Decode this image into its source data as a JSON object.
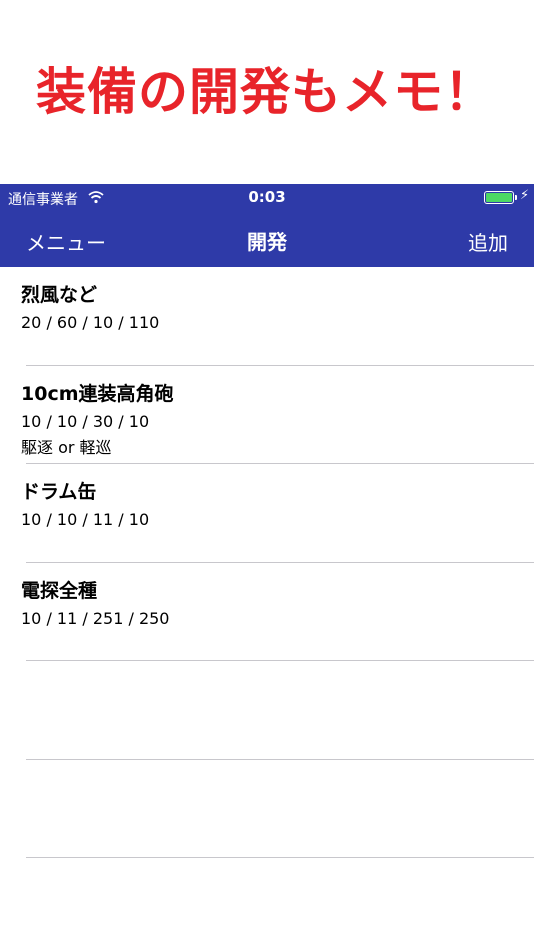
{
  "promo": {
    "title": "装備の開発もメモ！"
  },
  "status_bar": {
    "carrier": "通信事業者",
    "time": "0:03",
    "icons": [
      "wifi-icon",
      "battery-icon",
      "charging-icon"
    ]
  },
  "nav": {
    "left_label": "メニュー",
    "title": "開発",
    "right_label": "追加"
  },
  "colors": {
    "bar": "#2e3aa8",
    "promo_text": "#e8242a",
    "separator": "#c8c7cc",
    "battery": "#4cd964"
  },
  "items": [
    {
      "title": "烈風など",
      "values": "20 / 60 / 10 / 110",
      "note": ""
    },
    {
      "title": "10cm連装高角砲",
      "values": "10 / 10 / 30 / 10",
      "note": "駆逐 or 軽巡"
    },
    {
      "title": "ドラム缶",
      "values": "10 / 10 / 11 / 10",
      "note": ""
    },
    {
      "title": "電探全種",
      "values": "10 / 11 / 251 / 250",
      "note": ""
    }
  ]
}
